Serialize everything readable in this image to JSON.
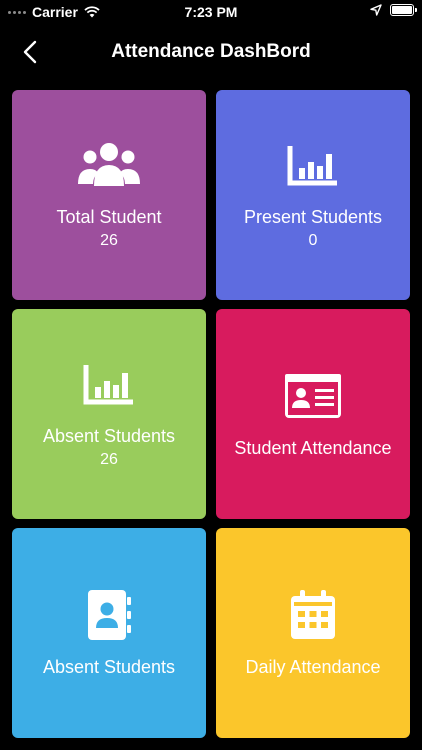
{
  "status_bar": {
    "carrier": "Carrier",
    "time": "7:23 PM",
    "icons": [
      "signal-dots-icon",
      "wifi-icon",
      "location-arrow-icon",
      "battery-icon"
    ]
  },
  "header": {
    "title": "Attendance DashBord",
    "back_icon": "chevron-left-icon"
  },
  "tiles": [
    {
      "label": "Total Student",
      "value": "26",
      "icon": "users-icon",
      "color": "#9d4f9d"
    },
    {
      "label": "Present Students",
      "value": "0",
      "icon": "bar-chart-icon",
      "color": "#5e6ce0"
    },
    {
      "label": "Absent Students",
      "value": "26",
      "icon": "bar-chart-icon",
      "color": "#99cc5c"
    },
    {
      "label": "Student Attendance",
      "icon": "id-card-icon",
      "color": "#d81b5e"
    },
    {
      "label": "Absent Students",
      "icon": "contact-book-icon",
      "color": "#3daee6"
    },
    {
      "label": "Daily Attendance",
      "icon": "calendar-icon",
      "color": "#fbc62b"
    }
  ]
}
